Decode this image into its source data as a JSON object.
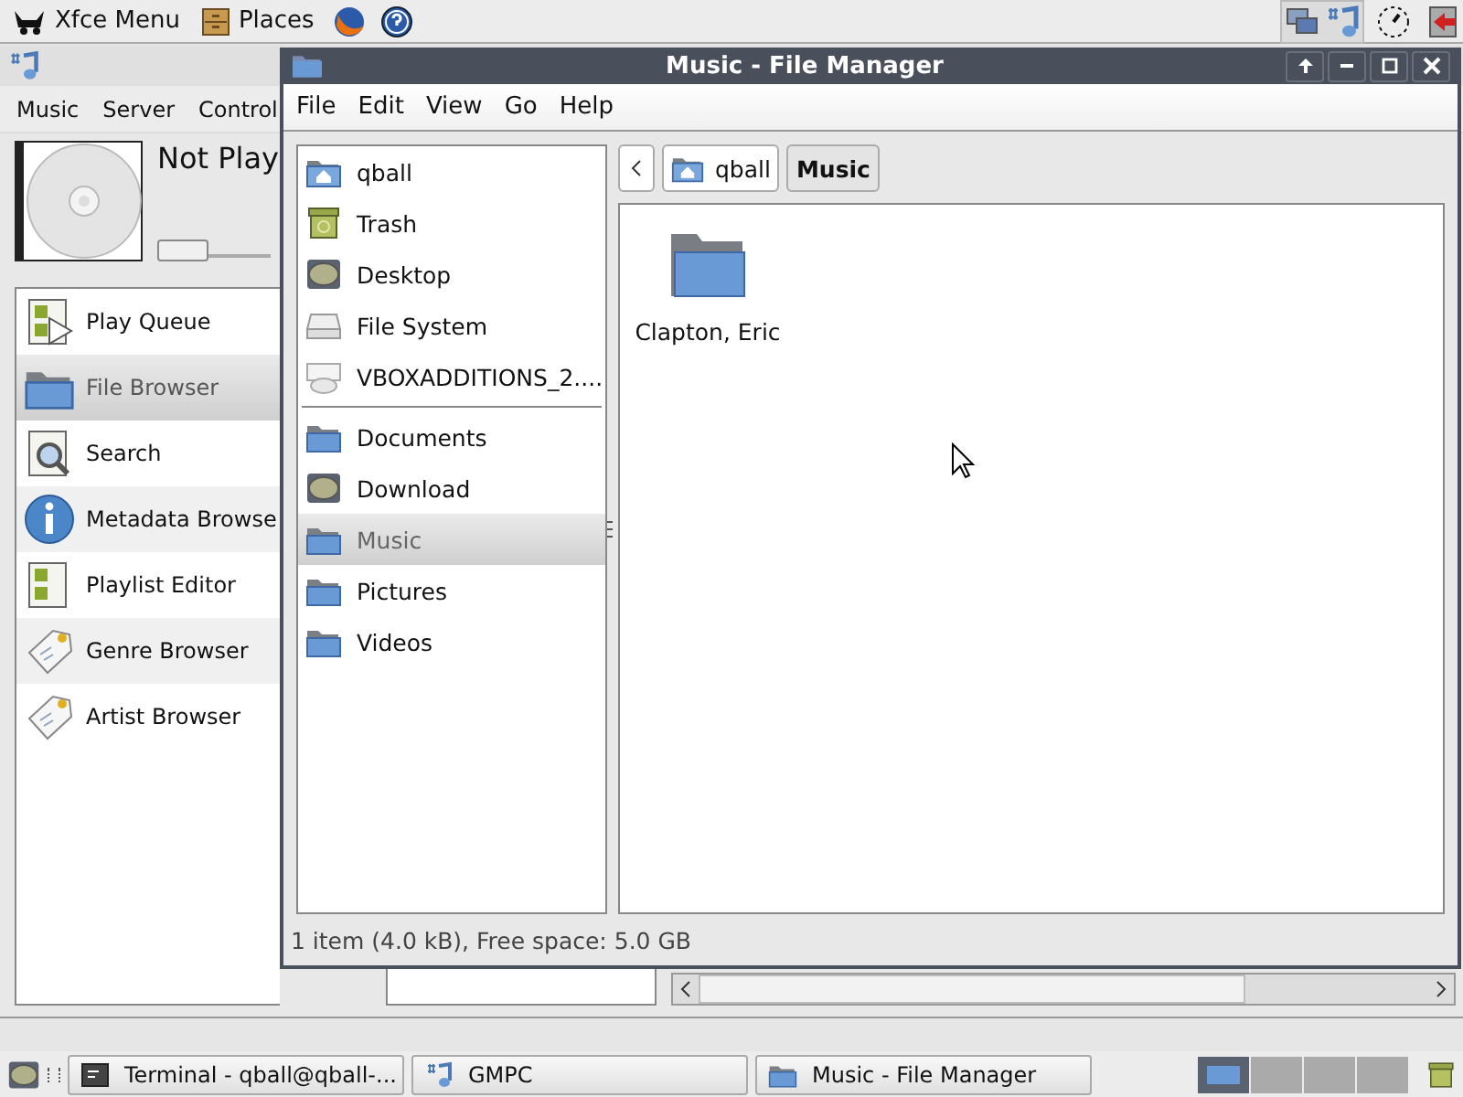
{
  "top_panel": {
    "menu": "Xfce Menu",
    "places": "Places"
  },
  "gmpc": {
    "menu": [
      "Music",
      "Server",
      "Control"
    ],
    "now_playing": "Not Play",
    "seek": {
      "level": 0
    },
    "sidebar": [
      {
        "label": "Play Queue",
        "kind": "queue",
        "selected": false
      },
      {
        "label": "File Browser",
        "kind": "folder",
        "selected": true
      },
      {
        "label": "Search",
        "kind": "search",
        "selected": false
      },
      {
        "label": "Metadata Browse",
        "kind": "info",
        "selected": false
      },
      {
        "label": "Playlist Editor",
        "kind": "playlist",
        "selected": false
      },
      {
        "label": "Genre Browser",
        "kind": "tag",
        "selected": false
      },
      {
        "label": "Artist Browser",
        "kind": "tag",
        "selected": false
      }
    ]
  },
  "file_manager": {
    "window": {
      "title": "Music - File Manager"
    },
    "menu": [
      "File",
      "Edit",
      "View",
      "Go",
      "Help"
    ],
    "devices": [
      {
        "label": "qball",
        "kind": "home",
        "selected": false
      },
      {
        "label": "Trash",
        "kind": "trash",
        "selected": false
      },
      {
        "label": "Desktop",
        "kind": "desktop",
        "selected": false
      },
      {
        "label": "File System",
        "kind": "drive",
        "selected": false
      },
      {
        "label": "VBOXADDITIONS_2....",
        "kind": "disc",
        "selected": false
      }
    ],
    "bookmarks": [
      {
        "label": "Documents",
        "kind": "folder",
        "selected": false
      },
      {
        "label": "Download",
        "kind": "desktop",
        "selected": false
      },
      {
        "label": "Music",
        "kind": "folder",
        "selected": true
      },
      {
        "label": "Pictures",
        "kind": "folder",
        "selected": false
      },
      {
        "label": "Videos",
        "kind": "folder",
        "selected": false
      }
    ],
    "path": [
      {
        "label": "qball",
        "kind": "home",
        "selected": false
      },
      {
        "label": "Music",
        "kind": "none",
        "selected": true
      }
    ],
    "files": [
      {
        "name": "Clapton, Eric"
      }
    ],
    "status_bar": "1 item (4.0 kB), Free space: 5.0 GB"
  },
  "taskbar": {
    "tasks": [
      {
        "label": "Terminal - qball@qball-...",
        "kind": "terminal"
      },
      {
        "label": "GMPC",
        "kind": "note"
      },
      {
        "label": "Music - File Manager",
        "kind": "folder"
      }
    ],
    "workspaces": [
      {
        "selected": true
      },
      {
        "selected": false
      },
      {
        "selected": false
      },
      {
        "selected": false
      }
    ]
  }
}
